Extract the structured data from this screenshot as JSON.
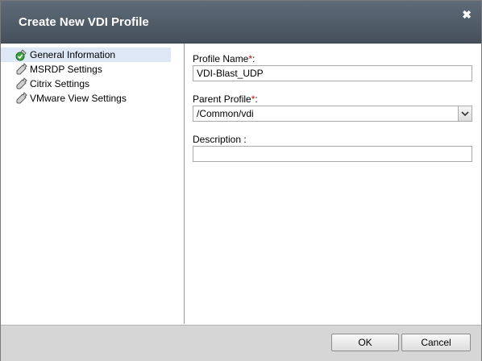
{
  "dialog": {
    "title": "Create New VDI Profile",
    "close_symbol": "✖"
  },
  "sidebar": {
    "items": [
      {
        "label": "General Information",
        "icon": "check-wrench-icon",
        "active": true
      },
      {
        "label": "MSRDP Settings",
        "icon": "wrench-icon",
        "active": false
      },
      {
        "label": "Citrix Settings",
        "icon": "wrench-icon",
        "active": false
      },
      {
        "label": "VMware View Settings",
        "icon": "wrench-icon",
        "active": false
      }
    ]
  },
  "form": {
    "profile_name_label": "Profile Name",
    "profile_name_value": "VDI-Blast_UDP",
    "parent_profile_label": "Parent Profile",
    "parent_profile_value": "/Common/vdi",
    "description_label": "Description",
    "description_suffix": " :",
    "description_value": "",
    "required_marker": "*",
    "label_colon": ":"
  },
  "footer": {
    "ok_label": "OK",
    "cancel_label": "Cancel"
  },
  "colors": {
    "titlebar": "#4f5a66",
    "active_item": "#dde7f5",
    "required": "#d00000"
  }
}
